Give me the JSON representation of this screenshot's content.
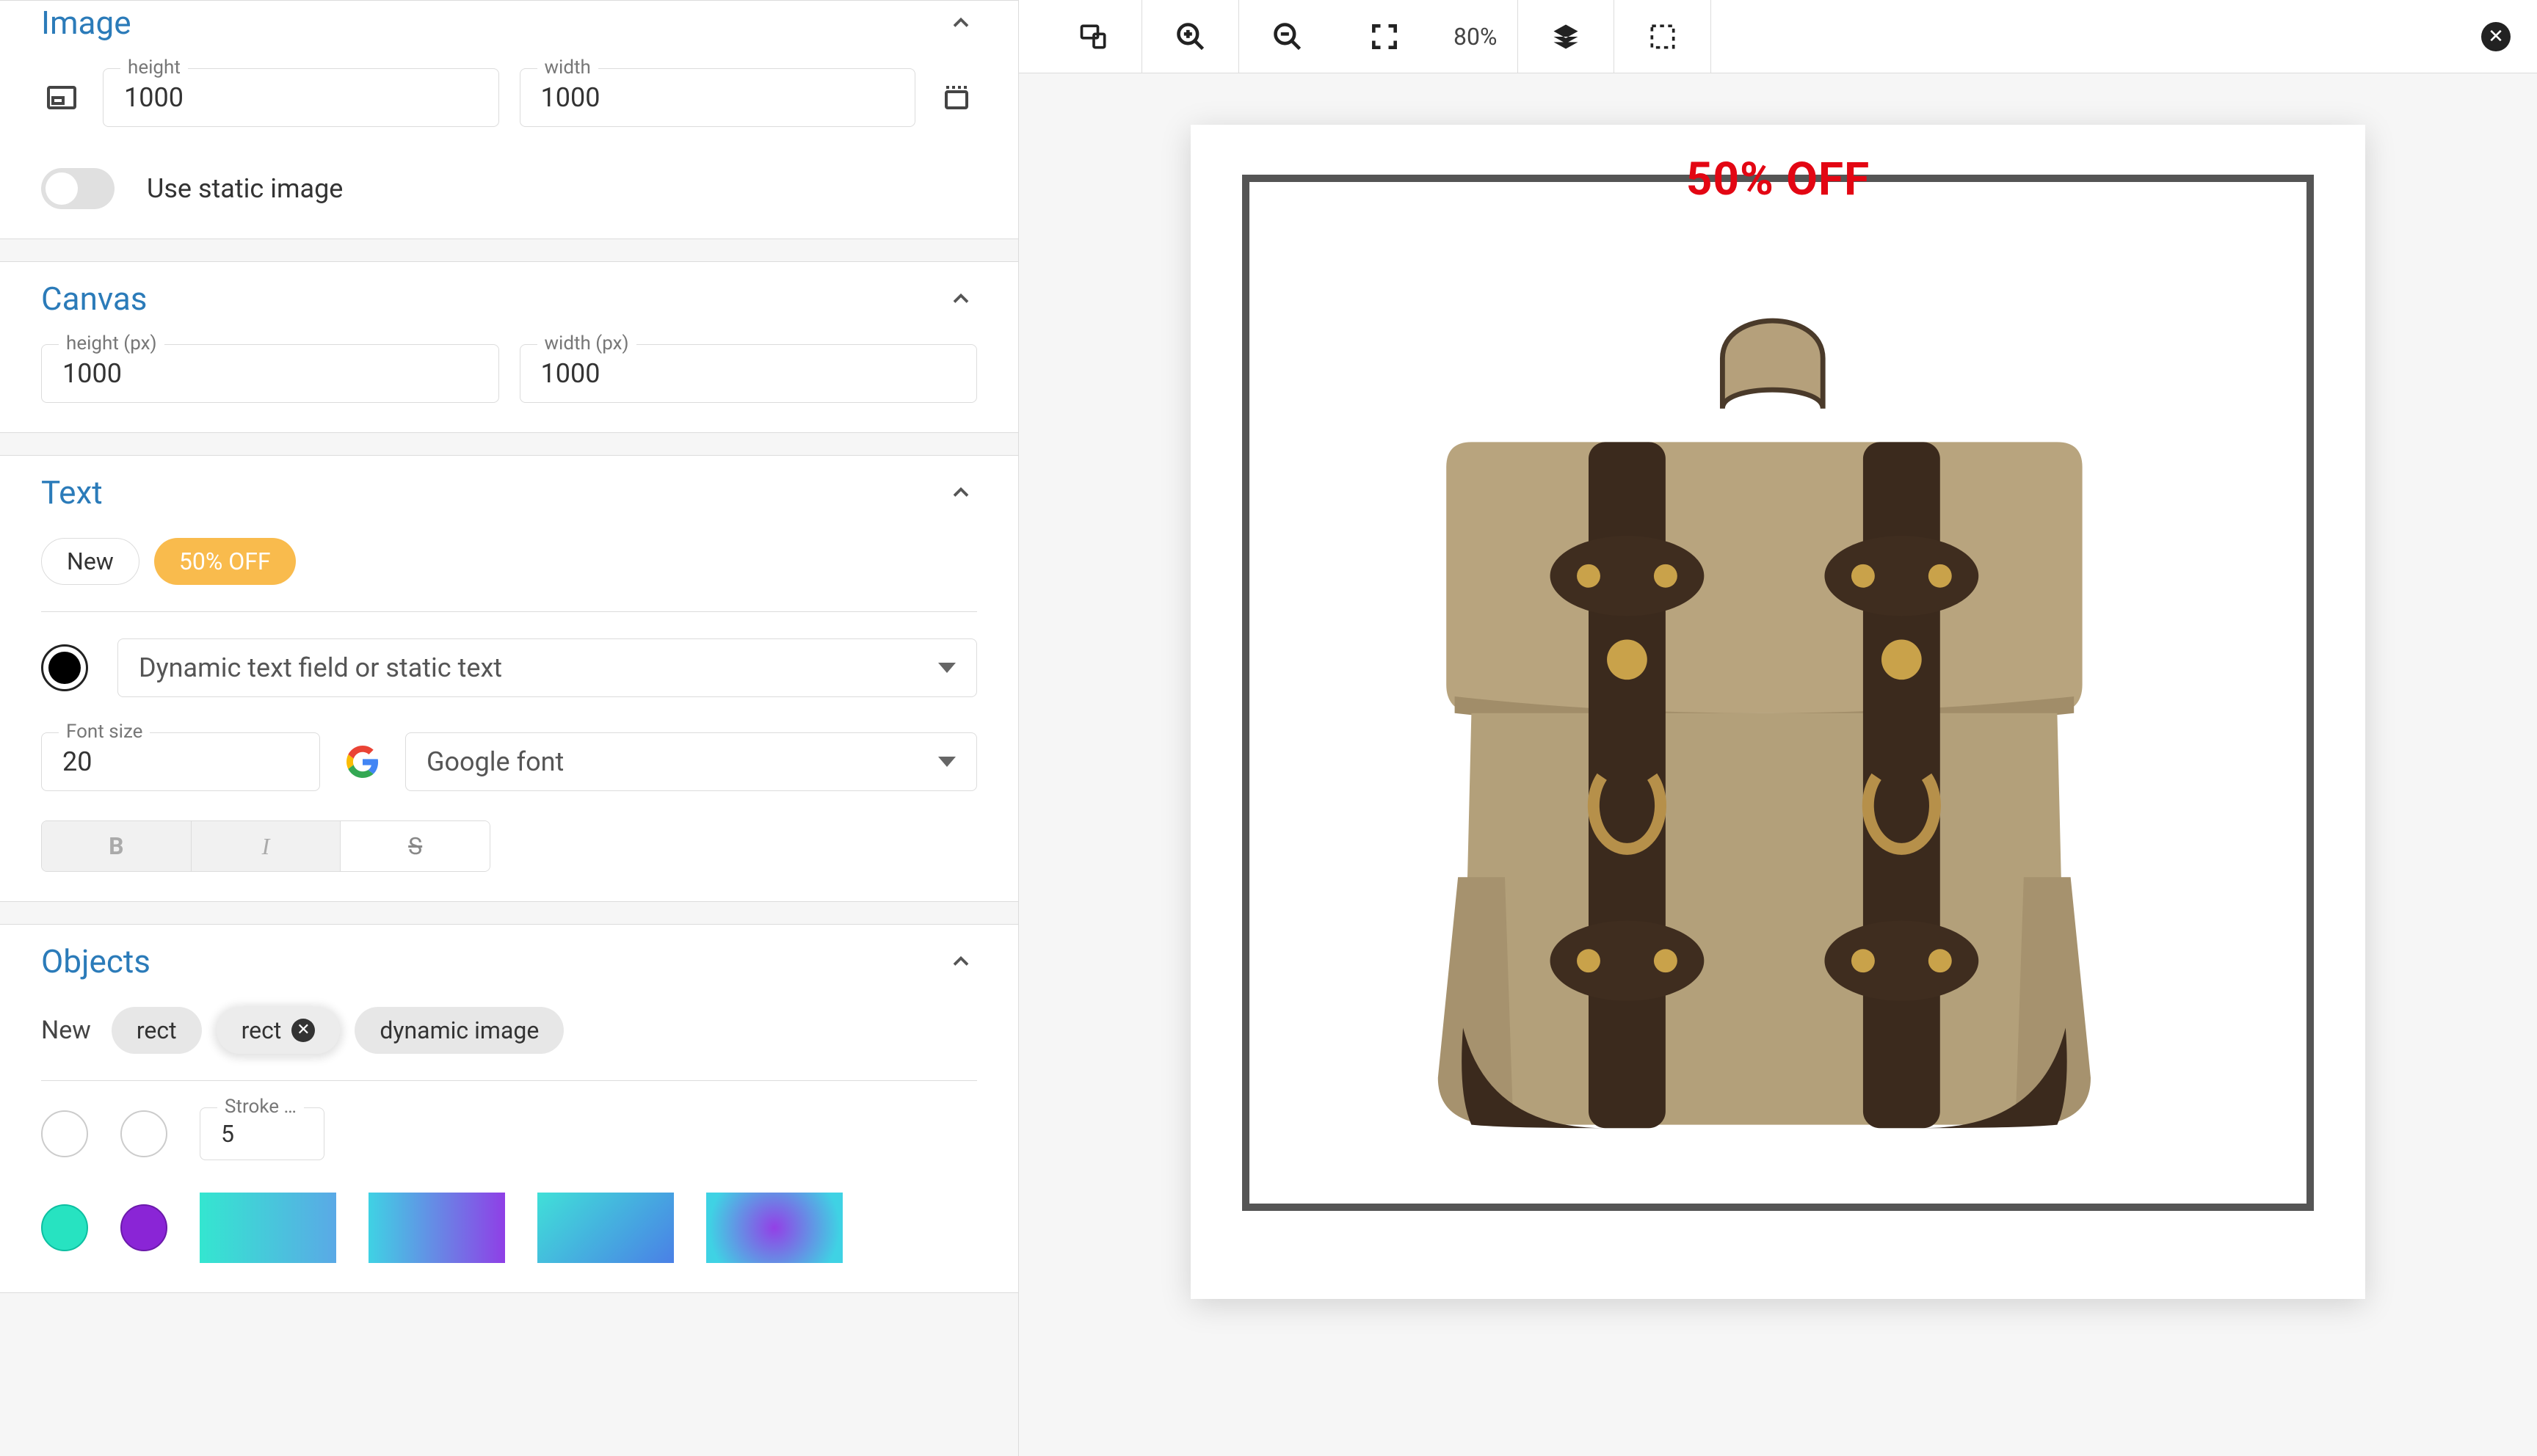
{
  "sections": {
    "image": {
      "title": "Image",
      "height_label": "height",
      "width_label": "width",
      "height_value": "1000",
      "width_value": "1000",
      "static_toggle_label": "Use static image"
    },
    "canvas": {
      "title": "Canvas",
      "height_label": "height (px)",
      "width_label": "width (px)",
      "height_value": "1000",
      "width_value": "1000"
    },
    "text": {
      "title": "Text",
      "new_label": "New",
      "chips": [
        "50% OFF"
      ],
      "text_select_label": "Dynamic text field or static text",
      "font_size_label": "Font size",
      "font_size_value": "20",
      "font_select_label": "Google font",
      "format": {
        "bold": "B",
        "italic": "I",
        "strike": "S"
      }
    },
    "objects": {
      "title": "Objects",
      "new_label": "New",
      "chips": [
        "rect",
        "rect",
        "dynamic image"
      ],
      "selected_index": 1,
      "stroke_label": "Stroke …",
      "stroke_value": "5",
      "colors": {
        "fill": "#ffffff",
        "stroke": "#ffffff",
        "teal": "#27e3c1",
        "purple": "#8a25d6"
      }
    }
  },
  "toolbar": {
    "zoom_label": "80%"
  },
  "canvas": {
    "promo_text": "50% OFF",
    "promo_color": "#e30613",
    "frame_stroke": "#555555",
    "frame_stroke_width": 10
  }
}
